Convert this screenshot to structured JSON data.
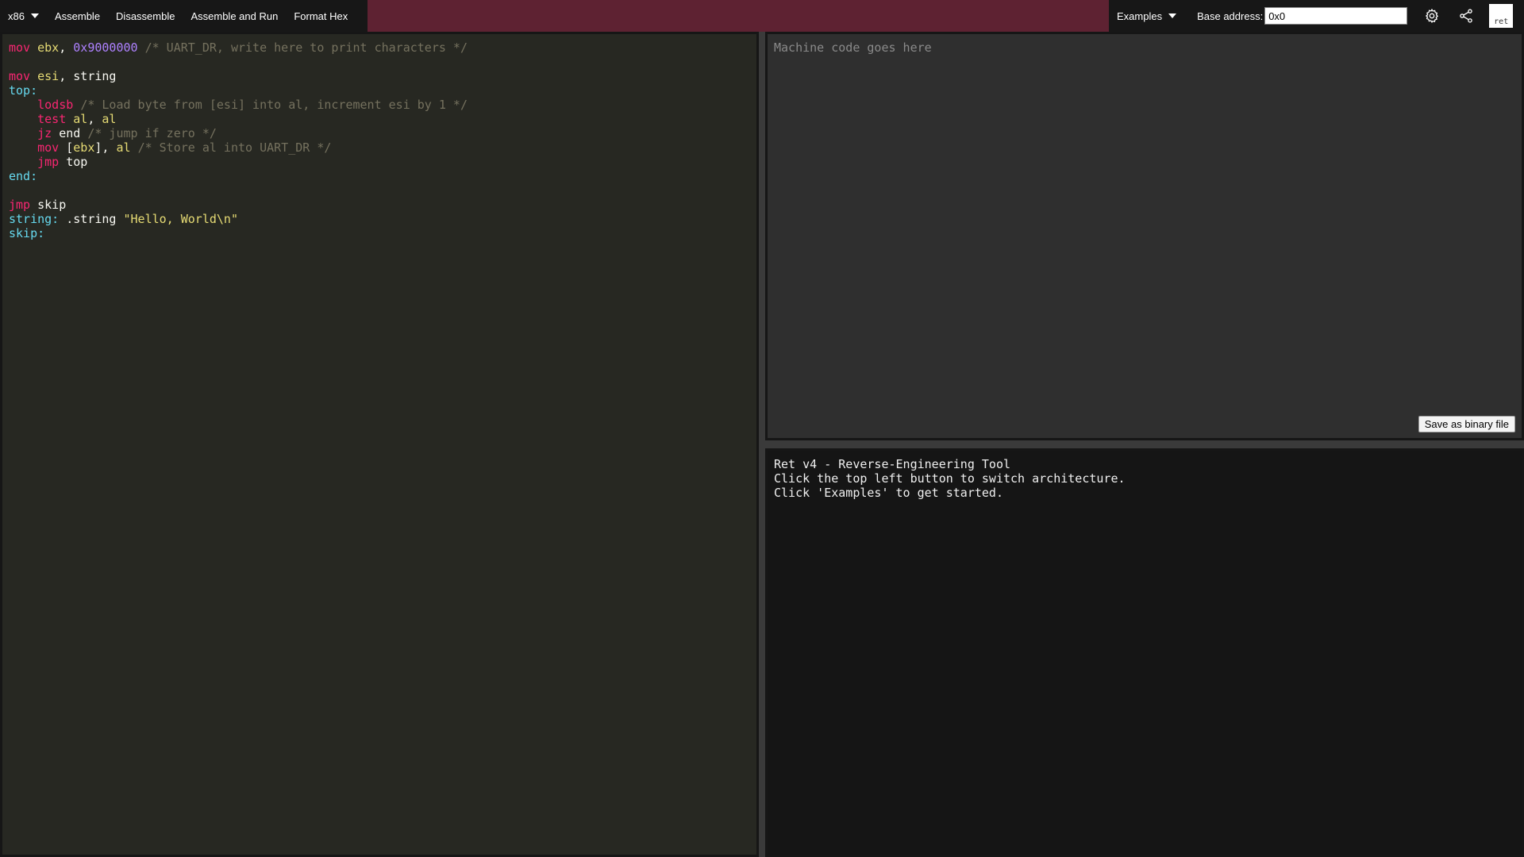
{
  "topbar": {
    "arch": "x86",
    "menu": [
      {
        "name": "assemble-button",
        "label": "Assemble"
      },
      {
        "name": "disassemble-button",
        "label": "Disassemble"
      },
      {
        "name": "assemble-and-run-button",
        "label": "Assemble and Run"
      },
      {
        "name": "format-hex-button",
        "label": "Format Hex"
      }
    ],
    "examples_label": "Examples",
    "base_address_label": "Base address:",
    "base_address_value": "0x0",
    "logo_text": "ret",
    "accent_color": "#5e2232"
  },
  "editor": {
    "lines": [
      [
        [
          "kw",
          "mov"
        ],
        [
          "t",
          " "
        ],
        [
          "reg",
          "ebx"
        ],
        [
          "t",
          ", "
        ],
        [
          "num",
          "0x9000000"
        ],
        [
          "t",
          " "
        ],
        [
          "cm",
          "/* UART_DR, write here to print characters */"
        ]
      ],
      [],
      [
        [
          "kw",
          "mov"
        ],
        [
          "t",
          " "
        ],
        [
          "reg",
          "esi"
        ],
        [
          "t",
          ", string"
        ]
      ],
      [
        [
          "lbl",
          "top:"
        ]
      ],
      [
        [
          "t",
          "    "
        ],
        [
          "kw",
          "lodsb"
        ],
        [
          "t",
          " "
        ],
        [
          "cm",
          "/* Load byte from [esi] into al, increment esi by 1 */"
        ]
      ],
      [
        [
          "t",
          "    "
        ],
        [
          "kw",
          "test"
        ],
        [
          "t",
          " "
        ],
        [
          "reg",
          "al"
        ],
        [
          "t",
          ", "
        ],
        [
          "reg",
          "al"
        ]
      ],
      [
        [
          "t",
          "    "
        ],
        [
          "kw",
          "jz"
        ],
        [
          "t",
          " end "
        ],
        [
          "cm",
          "/* jump if zero */"
        ]
      ],
      [
        [
          "t",
          "    "
        ],
        [
          "kw",
          "mov"
        ],
        [
          "t",
          " ["
        ],
        [
          "reg",
          "ebx"
        ],
        [
          "t",
          "], "
        ],
        [
          "reg",
          "al"
        ],
        [
          "t",
          " "
        ],
        [
          "cm",
          "/* Store al into UART_DR */"
        ]
      ],
      [
        [
          "t",
          "    "
        ],
        [
          "kw",
          "jmp"
        ],
        [
          "t",
          " top"
        ]
      ],
      [
        [
          "lbl",
          "end:"
        ]
      ],
      [],
      [
        [
          "kw",
          "jmp"
        ],
        [
          "t",
          " skip"
        ]
      ],
      [
        [
          "lbl",
          "string:"
        ],
        [
          "t",
          " .string "
        ],
        [
          "str",
          "\"Hello, World\\n\""
        ]
      ],
      [
        [
          "lbl",
          "skip:"
        ]
      ]
    ]
  },
  "machine_code": {
    "placeholder": "Machine code goes here",
    "value": "",
    "save_label": "Save as binary file"
  },
  "console": {
    "lines": [
      "Ret v4 - Reverse-Engineering Tool",
      "Click the top left button to switch architecture.",
      "Click 'Examples' to get started."
    ]
  },
  "icons": {
    "settings": "gear-icon",
    "share": "share-icon",
    "arch_dropdown": "caret-down-icon",
    "examples_dropdown": "caret-down-icon"
  }
}
